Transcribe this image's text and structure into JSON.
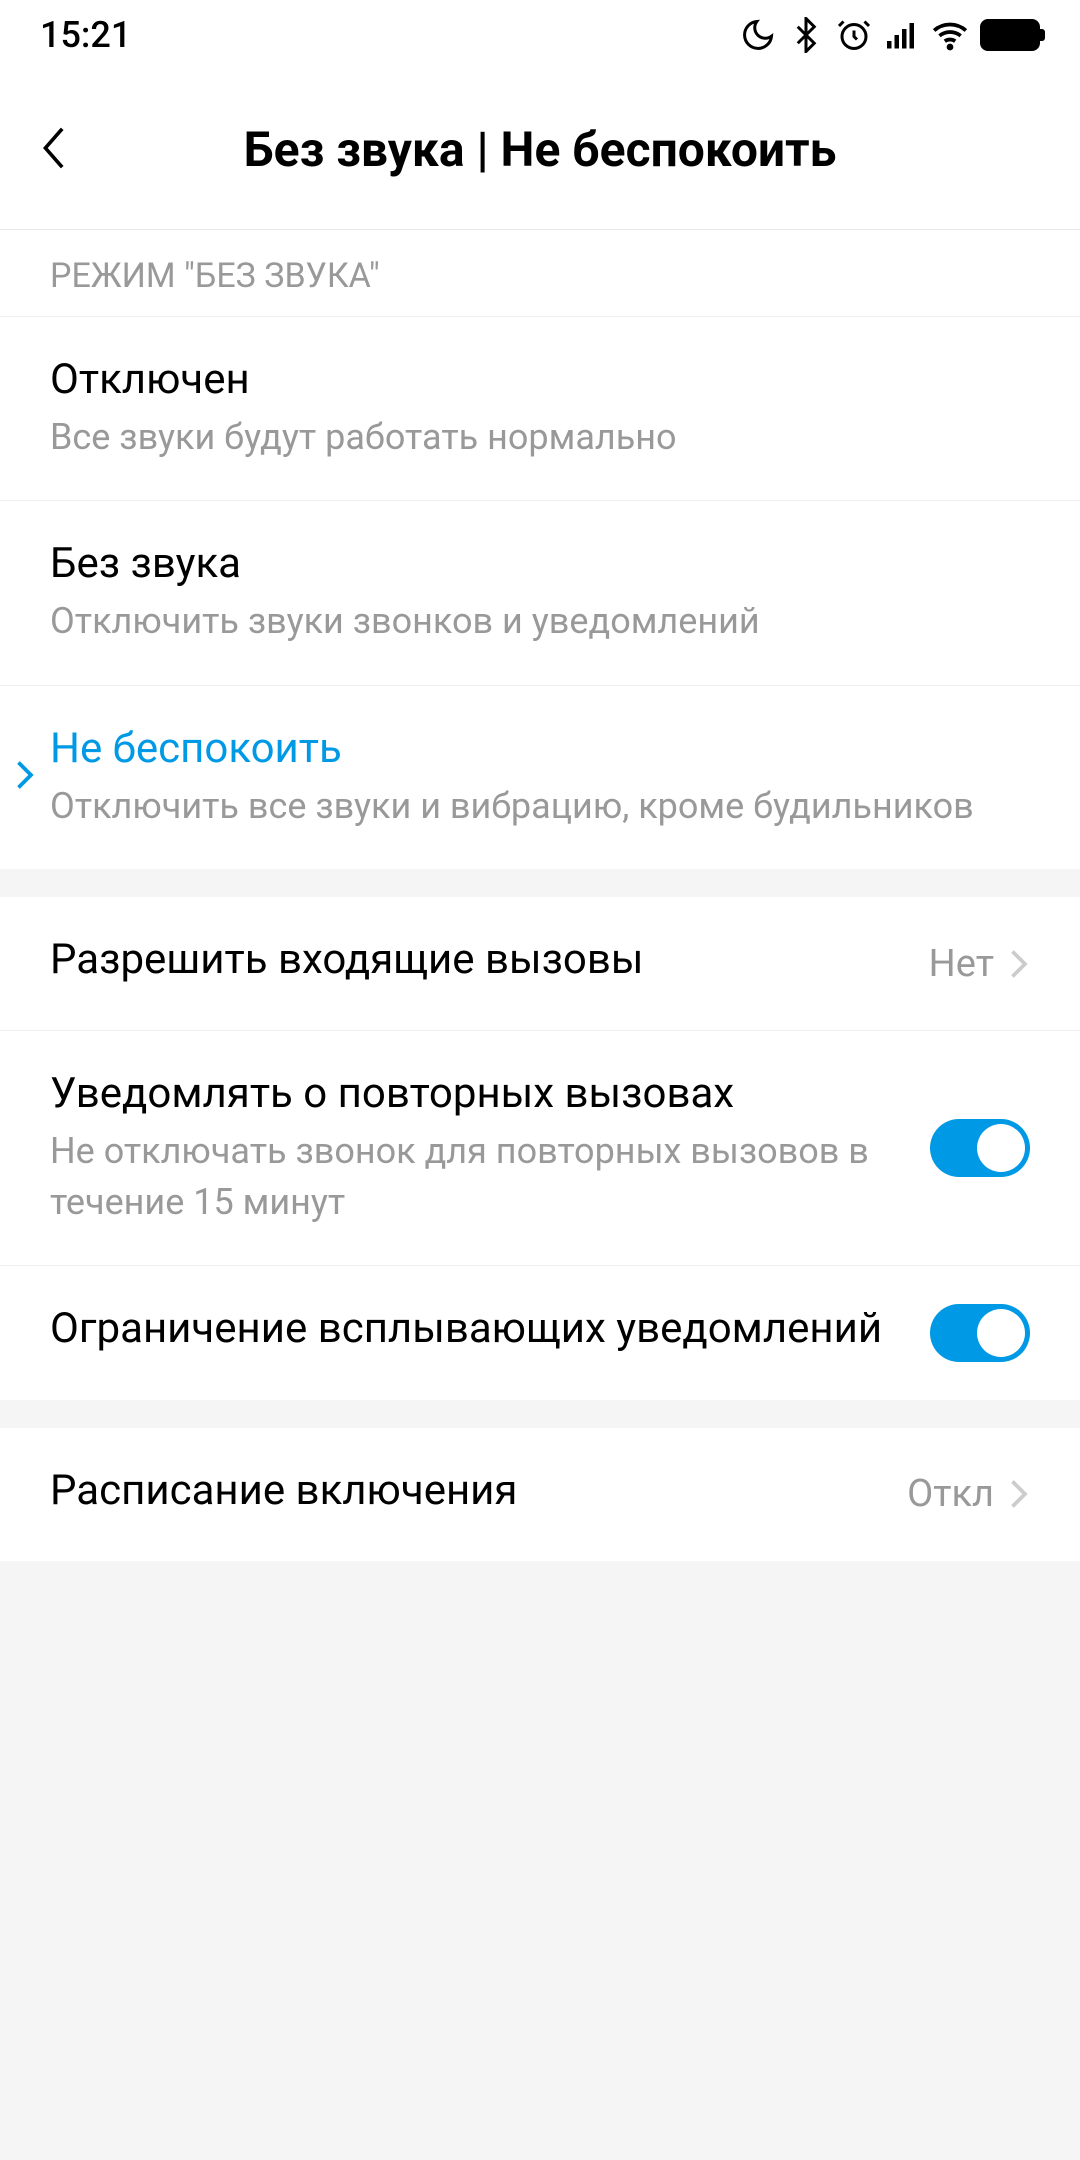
{
  "statusBar": {
    "time": "15:21"
  },
  "header": {
    "title": "Без звука | Не беспокоить"
  },
  "sections": {
    "silentMode": {
      "header": "РЕЖИМ \"БЕЗ ЗВУКА\"",
      "options": [
        {
          "title": "Отключен",
          "subtitle": "Все звуки будут работать нормально"
        },
        {
          "title": "Без звука",
          "subtitle": "Отключить звуки звонков и уведомлений"
        },
        {
          "title": "Не беспокоить",
          "subtitle": "Отключить все звуки и вибрацию, кроме будильников"
        }
      ]
    },
    "dnd": {
      "allowCalls": {
        "title": "Разрешить входящие вызовы",
        "value": "Нет"
      },
      "repeatCalls": {
        "title": "Уведомлять о повторных вызовах",
        "subtitle": "Не отключать звонок для повторных вызовов в течение 15 минут"
      },
      "popupLimit": {
        "title": "Ограничение всплывающих уведомлений"
      }
    },
    "schedule": {
      "title": "Расписание включения",
      "value": "Откл"
    }
  }
}
